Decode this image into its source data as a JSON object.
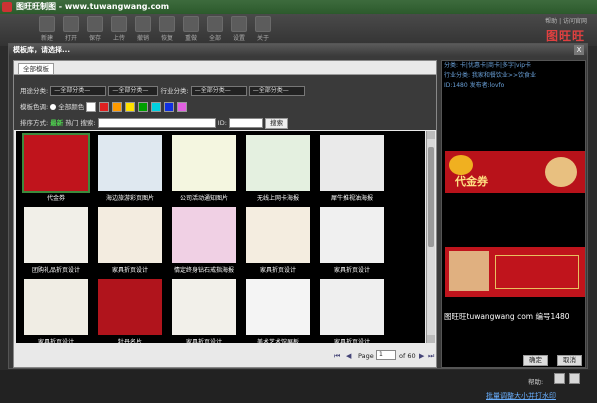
{
  "app": {
    "title": "图旺旺制图 - www.tuwangwang.com",
    "brand": "图旺旺",
    "links": "帮助 | 访问官网"
  },
  "toolbar": [
    "新建",
    "打开",
    "保存",
    "上传",
    "撤销",
    "恢复",
    "重做",
    "全部",
    "设置",
    "关于"
  ],
  "dialog": {
    "title": "模板库，请选择...",
    "close": "X",
    "tab": "全部模板",
    "labels": {
      "use": "用途分类:",
      "industry": "行业分类:",
      "color": "模板色调:",
      "sort": "排序方式:",
      "search": "搜索:",
      "id": "ID:"
    },
    "selects": {
      "use1": "—全部分类—",
      "use2": "—全部分类—",
      "ind1": "—全部分类—",
      "ind2": "—全部分类—"
    },
    "color_all": "全部颜色",
    "colors": [
      "#ffffff",
      "#e02020",
      "#ff9a00",
      "#ffe000",
      "#00a000",
      "#00d0e0",
      "#1030e0",
      "#e060e0"
    ],
    "sort_new": "最新",
    "sort_hot": "热门",
    "search_btn": "搜索",
    "ok": "确定",
    "cancel": "取消",
    "pager": {
      "page_label": "Page",
      "page": "1",
      "of": "of 60"
    }
  },
  "templates": [
    {
      "cap": "代金券",
      "col": "#c0141c"
    },
    {
      "cap": "海边旅游彩页图片",
      "col": "#dfe8f0"
    },
    {
      "cap": "公司活动通知图片",
      "col": "#f4f6e0"
    },
    {
      "cap": "无线上网卡海报",
      "col": "#e4f0e0"
    },
    {
      "cap": "犀牛推视油海报",
      "col": "#eaeaea"
    },
    {
      "cap": "团购礼品折页设计",
      "col": "#f1efe8"
    },
    {
      "cap": "家具折页设计",
      "col": "#f3ece0"
    },
    {
      "cap": "情定终身钻石戒指海报",
      "col": "#f0d0e4"
    },
    {
      "cap": "家具折页设计",
      "col": "#f4ede0"
    },
    {
      "cap": "家具折页设计",
      "col": "#f0f0f0"
    },
    {
      "cap": "家具折页设计",
      "col": "#f0ede4"
    },
    {
      "cap": "牡丹名片",
      "col": "#b0141c"
    },
    {
      "cap": "家具折页设计",
      "col": "#f2f0ea"
    },
    {
      "cap": "美术艺术馆展板",
      "col": "#f4f4f4"
    },
    {
      "cap": "家具折页设计",
      "col": "#efefef"
    }
  ],
  "right": {
    "info1": "分类: 卡|优惠卡|商卡|多字|vip卡",
    "info2": "行业分类: 我家和餐饮业>>饮食业",
    "info3": "ID:1480  发布者:lovfo",
    "watermark": "图旺旺tuwangwang com 编号1480",
    "prev_title": "代金券"
  },
  "bottom": {
    "help": "帮助:",
    "link": "批量调整大小并打水印"
  }
}
